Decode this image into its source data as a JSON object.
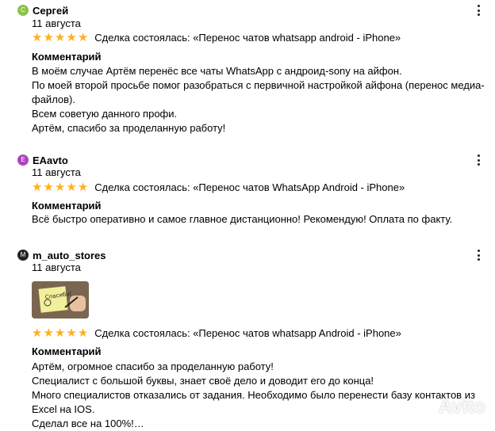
{
  "reviews": [
    {
      "avatar_letter": "С",
      "avatar_color": "#8bc34a",
      "author": "Сергей",
      "date": "11 августа",
      "stars": 5,
      "deal": "Сделка состоялась: «Перенос чатов whatsapp android - iPhone»",
      "comment_label": "Комментарий",
      "comment_lines": [
        "В моём случае Артём перенёс все чаты WhatsApp с андроид-sony на айфон.",
        "По моей второй просьбе помог разобраться с первичной настройкой айфона (перенос медиа-",
        "файлов).",
        "Всем советую данного профи.",
        "Артём, спасибо за проделанную работу!"
      ]
    },
    {
      "avatar_letter": "E",
      "avatar_color": "#ab47bc",
      "author": "EAavto",
      "date": "11 августа",
      "stars": 5,
      "deal": "Сделка состоялась: «Перенос чатов WhatsApp Android - iPhone»",
      "comment_label": "Комментарий",
      "comment_lines": [
        "Всё быстро оперативно и самое главное дистанционно! Рекомендую! Оплата по факту."
      ]
    },
    {
      "avatar_letter": "M",
      "avatar_color": "#222222",
      "author": "m_auto_stores",
      "date": "11 августа",
      "stars": 5,
      "photo_text": "Спасибо!",
      "deal": "Сделка состоялась: «Перенос чатов whatsapp Android - iPhone»",
      "comment_label": "Комментарий",
      "comment_lines": [
        "Артём, огромное спасибо за проделанную работу!",
        "Специалист с большой буквы, знает своё дело и доводит его до конца!",
        "Много специалистов отказались от задания. Необходимо было перенести базу контактов из",
        "Excel на IOS.",
        "Сделал все на 100%!…"
      ]
    }
  ],
  "watermark": "Avito",
  "colors": {
    "star": "#ffb021"
  }
}
